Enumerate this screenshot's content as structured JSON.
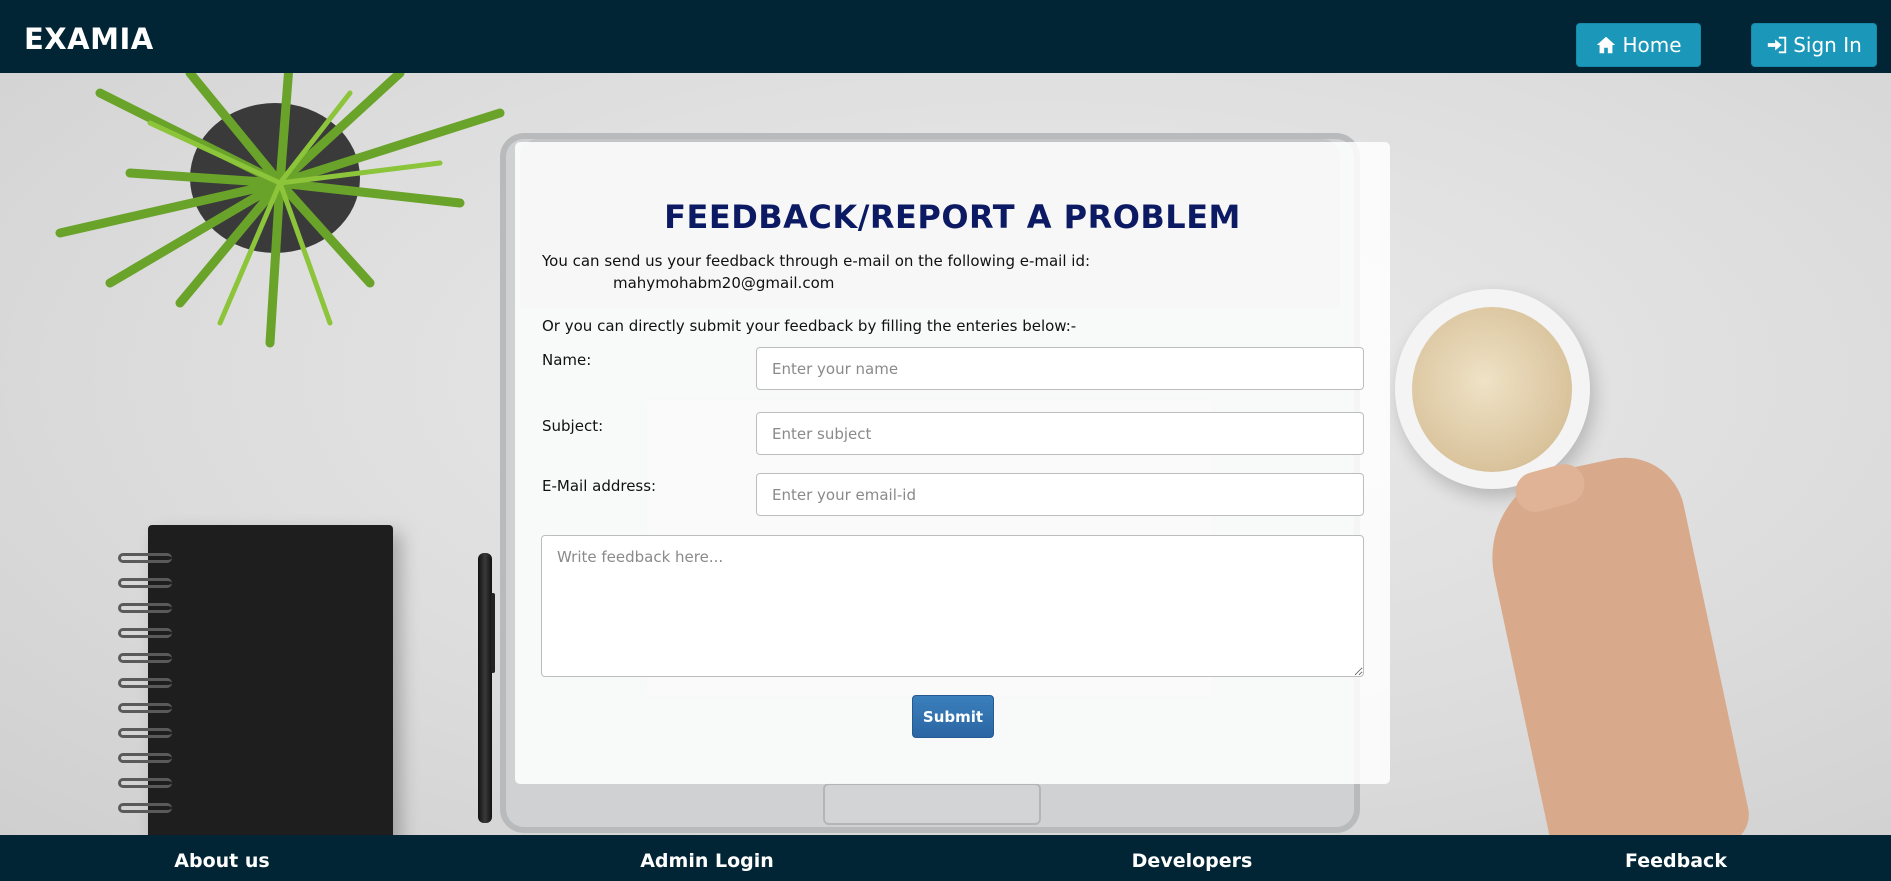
{
  "header": {
    "brand": "EXAMIA",
    "home_label": "Home",
    "signin_label": "Sign In"
  },
  "form": {
    "title": "FEEDBACK/REPORT A PROBLEM",
    "intro": "You can send us your feedback through e-mail on the following e-mail id:",
    "email_id": "mahymohabm20@gmail.com",
    "or_text": "Or you can directly submit your feedback by filling the enteries below:-",
    "name_label": "Name:",
    "name_placeholder": "Enter your name",
    "subject_label": "Subject:",
    "subject_placeholder": "Enter subject",
    "email_label": "E-Mail address:",
    "email_placeholder": "Enter your email-id",
    "feedback_placeholder": "Write feedback here...",
    "submit_label": "Submit"
  },
  "footer": {
    "links": [
      "About us",
      "Admin Login",
      "Developers",
      "Feedback"
    ]
  },
  "colors": {
    "navbar": "#022535",
    "nav_button": "#1b98b9",
    "title": "#0b1a63",
    "submit": "#2f6fae"
  },
  "icons": {
    "home": "home-icon",
    "signin": "sign-in-icon"
  }
}
